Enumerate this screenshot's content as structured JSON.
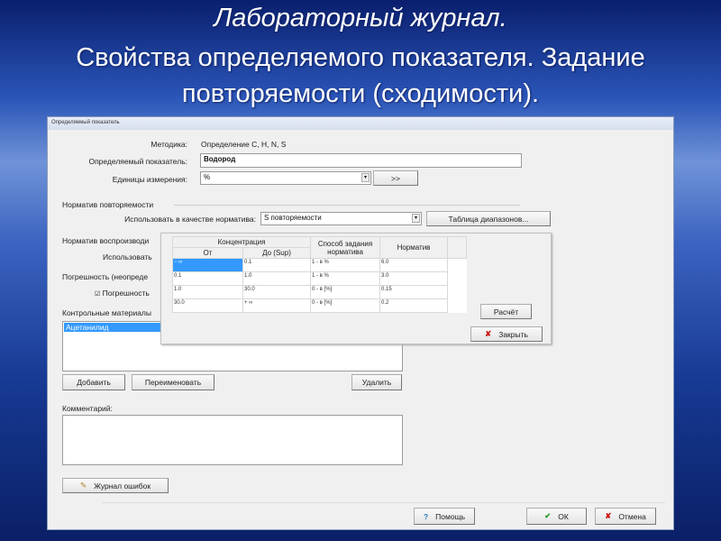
{
  "slide": {
    "title_line1": "Лабораторный журнал.",
    "title_line2": "Свойства определяемого показателя. Задание",
    "title_line3": "повторяемости (сходимости)."
  },
  "window": {
    "title": "Определяемый показатель",
    "method_label": "Методика:",
    "method_value": "Определение C, H, N, S",
    "indicator_label": "Определяемый показатель:",
    "indicator_value": "Водород",
    "units_label": "Единицы измерения:",
    "units_value": "%",
    "more_button": ">>",
    "repeat_group": "Норматив повторяемости",
    "use_as_label": "Использовать в качестве норматива:",
    "use_as_value": "S повторяемости",
    "ranges_button": "Таблица диапазонов...",
    "repro_group": "Норматив воспроизводи",
    "repro_use_label": "Использовать",
    "error_group": "Погрешность (неопреде",
    "error_checkbox": "Погрешность",
    "materials_label": "Контрольные материалы",
    "materials": [
      "Ацетанилид"
    ],
    "add_button": "Добавить",
    "rename_button": "Переименовать",
    "delete_button": "Удалить",
    "comment_label": "Комментарий:",
    "comment_value": "",
    "errors_log_button": "Журнал ошибок",
    "help_button": "Помощь",
    "ok_button": "ОК",
    "cancel_button": "Отмена"
  },
  "popup": {
    "header_concentration": "Концентрация",
    "col_from": "От",
    "col_to": "До (Sup)",
    "col_method": "Способ задания норматива",
    "col_norm": "Норматив",
    "rows": [
      [
        "− ∞",
        "0.1",
        "1 - в %",
        "6.0"
      ],
      [
        "0.1",
        "1.0",
        "1 - в %",
        "3.0"
      ],
      [
        "1.0",
        "30.0",
        "0 - в [%]",
        "0.15"
      ],
      [
        "30.0",
        "+ ∞",
        "0 - в [%]",
        "0.2"
      ]
    ],
    "calc_button": "Расчёт",
    "close_button": "Закрыть"
  },
  "colors": {
    "selection": "#3399ff",
    "ok_check": "#2a9a2a",
    "cancel_x": "#cc1111"
  }
}
